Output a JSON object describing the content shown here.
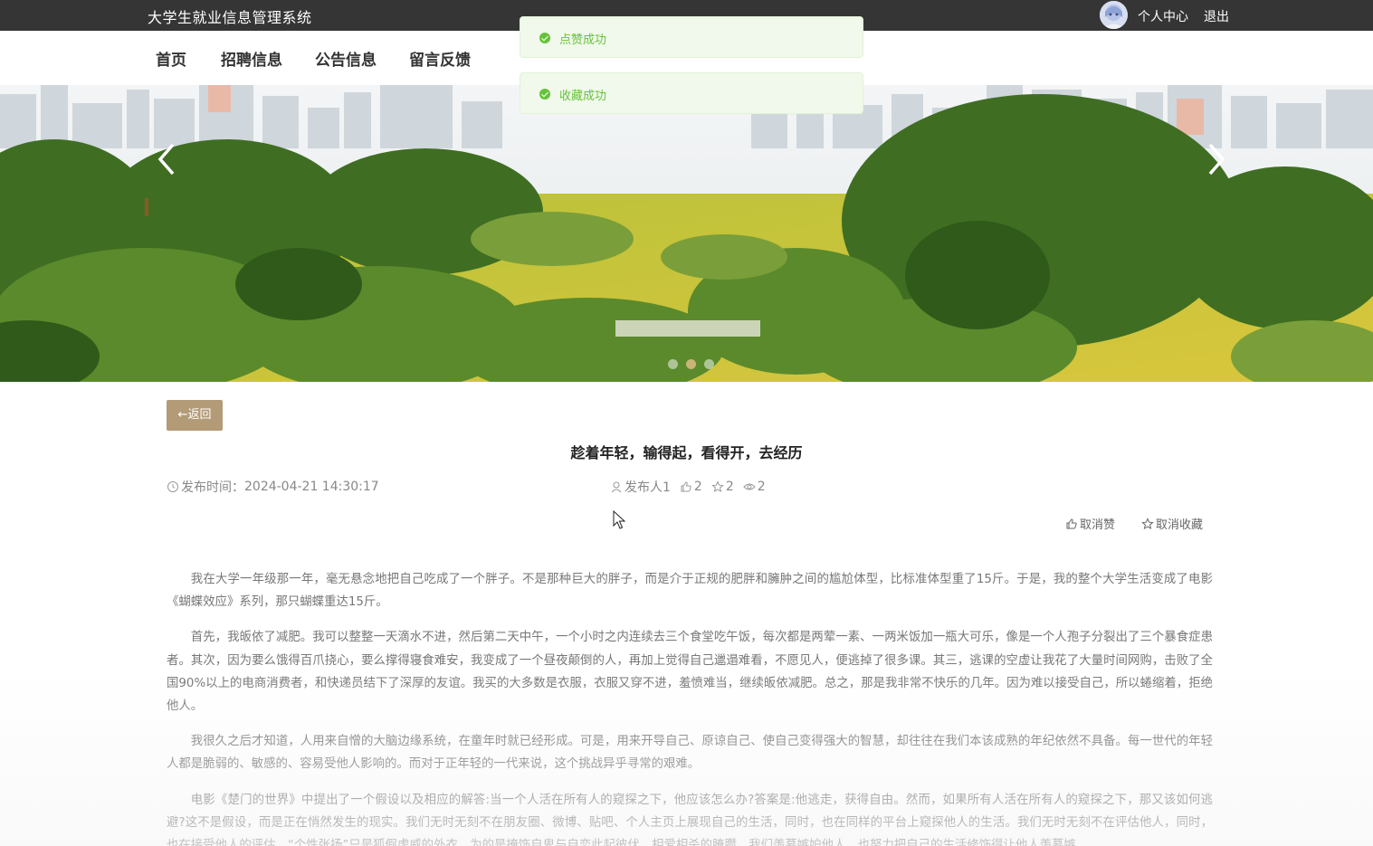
{
  "header": {
    "site_title": "大学生就业信息管理系统",
    "user_center": "个人中心",
    "logout": "退出"
  },
  "nav": {
    "items": [
      "首页",
      "招聘信息",
      "公告信息",
      "留言反馈"
    ]
  },
  "toasts": [
    {
      "message": "点赞成功"
    },
    {
      "message": "收藏成功"
    }
  ],
  "banner": {
    "slide_count": 3,
    "active_slide": 2
  },
  "article": {
    "back_label": "返回",
    "title": "趁着年轻，输得起，看得开，去经历",
    "publish_label": "发布时间：",
    "publish_time": "2024-04-21 14:30:17",
    "author": "发布人1",
    "likes": "2",
    "favorites": "2",
    "views": "2",
    "unlike_label": "取消赞",
    "unfavorite_label": "取消收藏",
    "paragraphs": [
      "我在大学一年级那一年，毫无悬念地把自己吃成了一个胖子。不是那种巨大的胖子，而是介于正规的肥胖和臃肿之间的尴尬体型，比标准体型重了15斤。于是，我的整个大学生活变成了电影《蝴蝶效应》系列，那只蝴蝶重达15斤。",
      "首先，我皈依了减肥。我可以整整一天滴水不进，然后第二天中午，一个小时之内连续去三个食堂吃午饭，每次都是两荤一素、一两米饭加一瓶大可乐，像是一个人孢子分裂出了三个暴食症患者。其次，因为要么饿得百爪挠心，要么撑得寝食难安，我变成了一个昼夜颠倒的人，再加上觉得自己邋遢难看，不愿见人，便逃掉了很多课。其三，逃课的空虚让我花了大量时间网购，击败了全国90%以上的电商消费者，和快递员结下了深厚的友谊。我买的大多数是衣服，衣服又穿不进，羞愤难当，继续皈依减肥。总之，那是我非常不快乐的几年。因为难以接受自己，所以蜷缩着，拒绝他人。",
      "我很久之后才知道，人用来自憎的大脑边缘系统，在童年时就已经形成。可是，用来开导自己、原谅自己、使自己变得强大的智慧，却往往在我们本该成熟的年纪依然不具备。每一世代的年轻人都是脆弱的、敏感的、容易受他人影响的。而对于正年轻的一代来说，这个挑战异乎寻常的艰难。",
      "电影《楚门的世界》中提出了一个假设以及相应的解答:当一个人活在所有人的窥探之下，他应该怎么办?答案是:他逃走，获得自由。然而，如果所有人活在所有人的窥探之下，那又该如何逃避?这不是假设，而是正在悄然发生的现实。我们无时无刻不在朋友圈、微博、贴吧、个人主页上展现自己的生活，同时，也在同样的平台上窥探他人的生活。我们无时无刻不在评估他人，同时，也在接受他人的评估。“个性张扬”只是狐假虎威的外衣，为的是掩饰自卑与自恋此起彼伏、相爱相杀的腌臜。我们羡慕嫉妒他人，也努力把自己的生活修饰得让他人羡慕嫉"
    ]
  }
}
